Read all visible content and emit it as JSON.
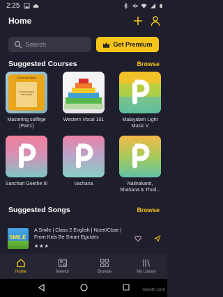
{
  "status_bar": {
    "time": "2:25"
  },
  "header": {
    "title": "Home"
  },
  "search": {
    "placeholder": "Search"
  },
  "premium": {
    "label": "Get Premium"
  },
  "courses_section": {
    "title": "Suggested Courses",
    "browse_label": "Browse",
    "courses": [
      {
        "title": "Mastering solfège (Part1)",
        "thumb_text_top": "Generalsolfège",
        "thumb_text_bottom": "SOLFEGE DES SOLFEGES"
      },
      {
        "title": "Western Vocal 101"
      },
      {
        "title": "Malayalam Light Music V"
      },
      {
        "title": "Sanchari Geethe III"
      },
      {
        "title": "Vachana"
      },
      {
        "title": "Nalinakanti, Shahana & Thod..."
      }
    ]
  },
  "songs_section": {
    "title": "Suggested Songs",
    "browse_label": "Browse",
    "songs": [
      {
        "title": "A Smile | Class 2 English | Ncert/Cbse | From Kids Be Smart Eguides",
        "rating": "★★★",
        "thumb_text": "SMILE"
      }
    ]
  },
  "bottom_nav": {
    "items": [
      {
        "label": "Home",
        "icon": "home-icon",
        "active": true
      },
      {
        "label": "Mentor",
        "icon": "mentor-icon",
        "active": false
      },
      {
        "label": "Browse",
        "icon": "browse-icon",
        "active": false
      },
      {
        "label": "My Library",
        "icon": "library-icon",
        "active": false
      }
    ]
  },
  "colors": {
    "background": "#1e1e2c",
    "accent": "#f7c51a",
    "search_bg": "#353543",
    "nav_bg": "#262633"
  },
  "watermark": "wsxdn.com"
}
